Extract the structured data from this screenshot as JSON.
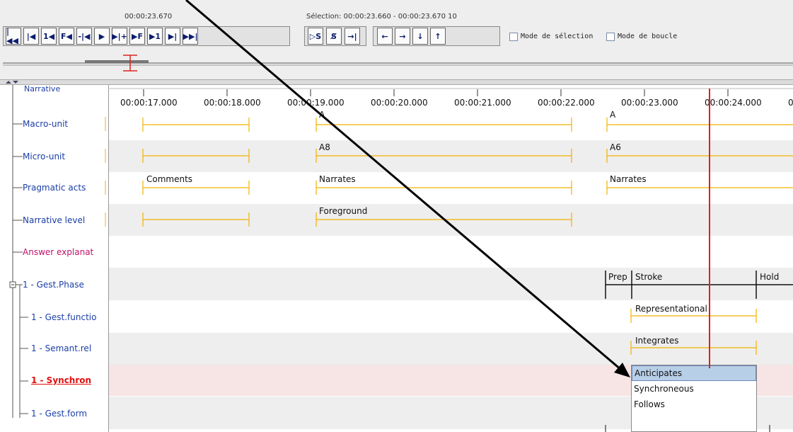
{
  "toolbar": {
    "time": "00:00:23.670",
    "selection": "Sélection: 00:00:23.660 - 00:00:23.670  10",
    "buttons": [
      "|◀◀",
      "|◀",
      "1◀",
      "F◀",
      "-|◀",
      "▶",
      "▶|+",
      "▶F",
      "▶1",
      "▶|",
      "▶▶|"
    ],
    "sel_buttons": [
      "▷S",
      "S̸",
      "→|"
    ],
    "arrow_buttons": [
      "←",
      "→",
      "↓",
      "↑"
    ],
    "mode_selection": "Mode de sélection",
    "mode_boucle": "Mode de boucle"
  },
  "timeline": {
    "top_tier": "Narrative",
    "ticks": [
      "00:00:17.000",
      "00:00:18.000",
      "00:00:19.000",
      "00:00:20.000",
      "00:00:21.000",
      "00:00:22.000",
      "00:00:23.000",
      "00:00:24.000",
      "0"
    ]
  },
  "tiers": [
    {
      "label": "Macro-unit",
      "color": "#1a3ea6"
    },
    {
      "label": "Micro-unit",
      "color": "#1a3ea6"
    },
    {
      "label": "Pragmatic acts",
      "color": "#1a3ea6"
    },
    {
      "label": "Narrative level",
      "color": "#1a3ea6"
    },
    {
      "label": "Answer explanat",
      "color": "#c0126a"
    },
    {
      "label": "1 - Gest.Phase",
      "color": "#1a3ea6"
    },
    {
      "label": "1 - Gest.functio",
      "color": "#1a3ea6"
    },
    {
      "label": "1 - Semant.rel",
      "color": "#1a3ea6"
    },
    {
      "label": "1 - Synchron",
      "color": "#e01010"
    },
    {
      "label": "1 - Gest.form",
      "color": "#1a3ea6"
    }
  ],
  "annotations": {
    "macro": [
      "A",
      "A"
    ],
    "micro": [
      "A8",
      "A6"
    ],
    "pragmatic": [
      "Comments",
      "Narrates",
      "Narrates"
    ],
    "narrative_level": [
      "Foreground"
    ],
    "phase": [
      "Prep",
      "Stroke",
      "Hold"
    ],
    "function": [
      "Representational"
    ],
    "semantic": [
      "Integrates"
    ]
  },
  "dropdown": {
    "options": [
      "Anticipates",
      "Synchroneous",
      "Follows"
    ],
    "selected": "Anticipates"
  },
  "colors": {
    "annotation_line": "#f2b200",
    "cursor": "#e02020",
    "selected_row": "#f7e4e4",
    "dropdown_selected": "#b8cfe8"
  }
}
